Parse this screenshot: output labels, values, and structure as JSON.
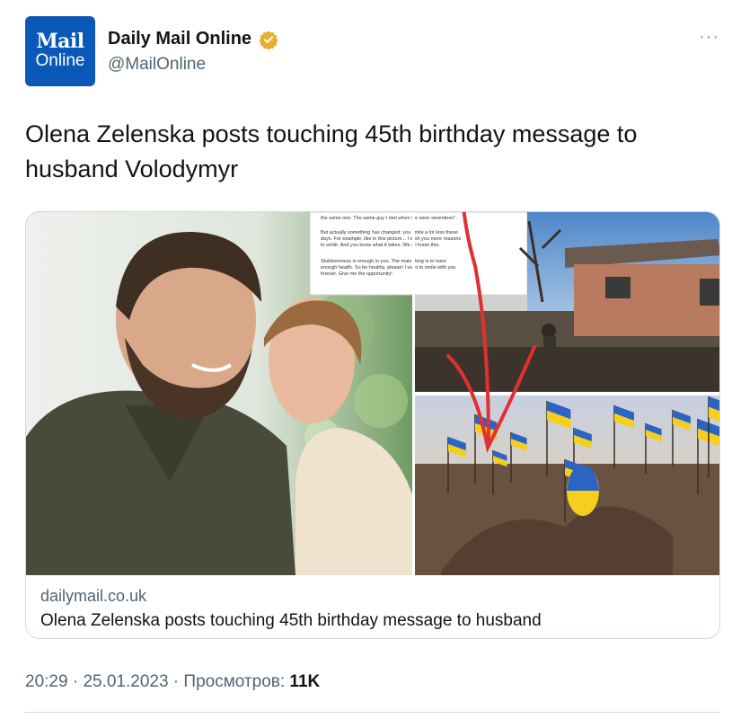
{
  "author": {
    "avatar_line1": "Mail",
    "avatar_line2": "Online",
    "name": "Daily Mail Online",
    "handle": "@MailOnline",
    "verified_icon": "verified-badge-icon",
    "more_label": "···"
  },
  "tweet": {
    "text": "Olena Zelenska posts touching 45th birthday message to husband Volodymyr"
  },
  "card": {
    "domain": "dailymail.co.uk",
    "title": "Olena Zelenska posts touching 45th birthday message to husband",
    "screenshot_text": [
      "the same one. The same guy I met when we were seventeen\".",
      "But actually something has changed: you smile a lot less these",
      "days. For example, like in this picture... I wish you more reasons",
      "to smile. And you know what it takes. We all know this.",
      "Stubbornness is enough in you. The main thing is to have",
      "enough health. So be healthy, please! I want to smile with you",
      "forever. Give me the opportunity!"
    ]
  },
  "meta": {
    "time": "20:29",
    "sep1": " · ",
    "date": "25.01.2023",
    "sep2": " · ",
    "views_label": "Просмотров: ",
    "views_value": "11K"
  },
  "colors": {
    "avatar_bg": "#0a58b8",
    "verified": "#e8b02a",
    "annotation": "#e0302f",
    "ua_blue": "#2c64c4",
    "ua_yellow": "#f4d01c"
  }
}
